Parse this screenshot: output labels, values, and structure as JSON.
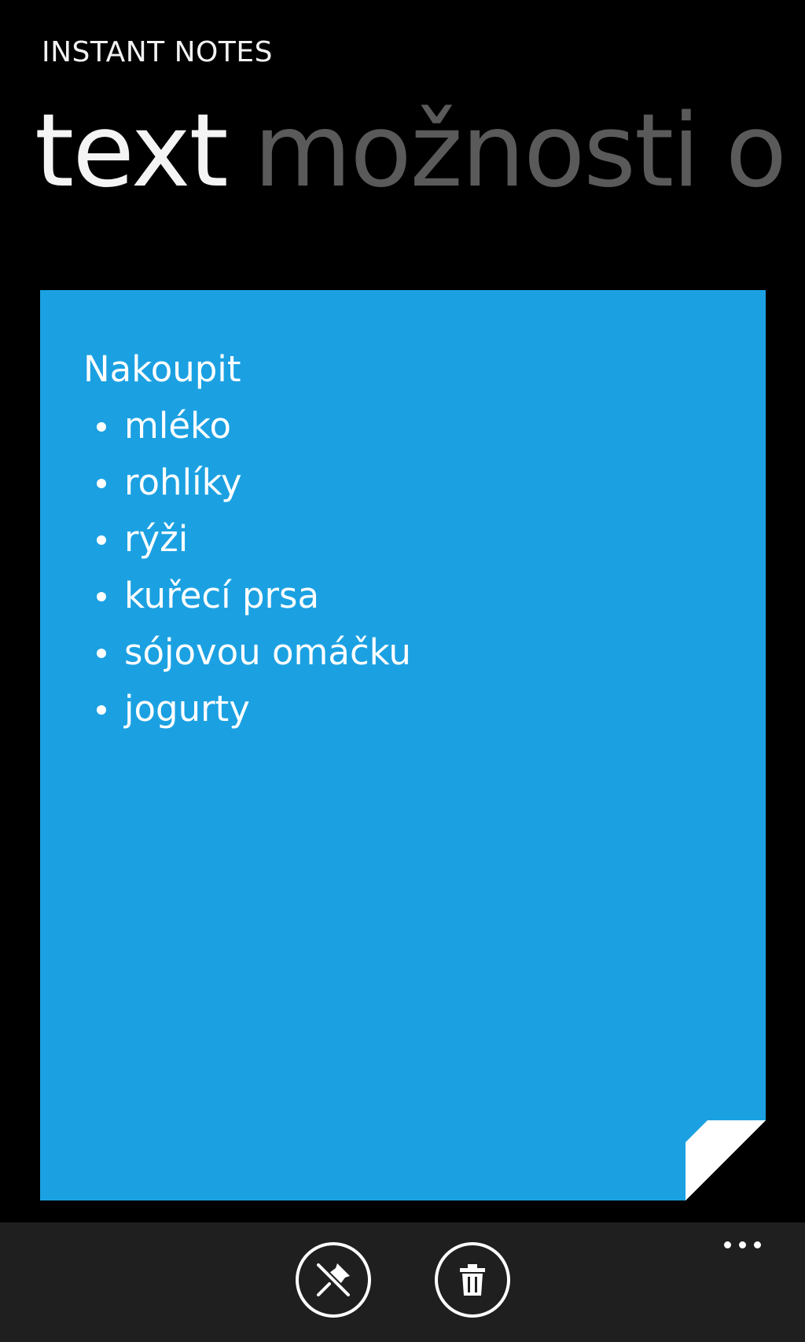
{
  "app": {
    "title": "INSTANT NOTES"
  },
  "pivot": {
    "items": [
      {
        "label": "text",
        "active": true
      },
      {
        "label": "možnosti",
        "active": false
      },
      {
        "label": "o",
        "active": false
      }
    ]
  },
  "note": {
    "background_color": "#1ba1e2",
    "heading": "Nakoupit",
    "items": [
      "mléko",
      "rohlíky",
      "rýži",
      "kuřecí prsa",
      "sójovou omáčku",
      "jogurty"
    ]
  },
  "app_bar": {
    "buttons": [
      {
        "icon": "unpin-icon"
      },
      {
        "icon": "trash-icon"
      }
    ],
    "more_icon": "ellipsis-icon"
  }
}
